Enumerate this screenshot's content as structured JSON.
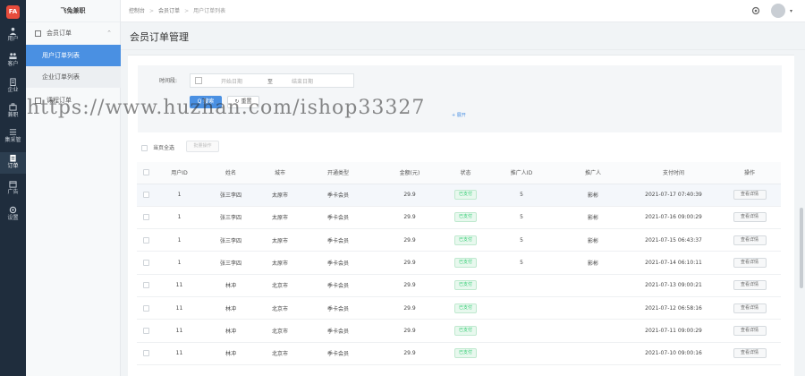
{
  "app": {
    "logo_text": "FA"
  },
  "rail": {
    "items": [
      {
        "label": "用户",
        "icon": "user-icon"
      },
      {
        "label": "客户",
        "icon": "customer-icon"
      },
      {
        "label": "企业",
        "icon": "building-icon"
      },
      {
        "label": "兼职",
        "icon": "briefcase-icon"
      },
      {
        "label": "集采管",
        "icon": "list-icon"
      },
      {
        "label": "订单",
        "icon": "order-icon",
        "active": true
      },
      {
        "label": "广告",
        "icon": "calendar-icon"
      },
      {
        "label": "设置",
        "icon": "gear-icon"
      }
    ]
  },
  "sidebar": {
    "brand": "飞兔兼职",
    "group1": "会员订单",
    "sub1": "用户订单列表",
    "sub2": "企业订单列表",
    "group2": "课程订单"
  },
  "breadcrumb": {
    "items": [
      "控制台",
      "会员订单",
      "用户订单列表"
    ]
  },
  "page": {
    "title": "会员订单管理"
  },
  "filter": {
    "label": "时间段:",
    "start_placeholder": "开始日期",
    "to": "至",
    "end_placeholder": "结束日期",
    "search_label": "Q 搜索",
    "reset_label": "↻ 重置",
    "expand_label": "+ 展开"
  },
  "toolbar": {
    "select_all": "当页全选",
    "batch_label": "批量操作"
  },
  "table": {
    "columns": [
      "用户ID",
      "姓名",
      "城市",
      "开通类型",
      "金额(元)",
      "状态",
      "推广人ID",
      "推广人",
      "支付时间",
      "操作"
    ],
    "rows": [
      {
        "id": "1",
        "name": "张三李四",
        "city": "太原市",
        "type": "季卡会员",
        "amount": "29.9",
        "status": "已支付",
        "pid": "5",
        "promoter": "影彬",
        "time": "2021-07-17 07:40:39",
        "action": "查看详情"
      },
      {
        "id": "1",
        "name": "张三李四",
        "city": "太原市",
        "type": "季卡会员",
        "amount": "29.9",
        "status": "已支付",
        "pid": "5",
        "promoter": "影彬",
        "time": "2021-07-16 09:00:29",
        "action": "查看详情"
      },
      {
        "id": "1",
        "name": "张三李四",
        "city": "太原市",
        "type": "季卡会员",
        "amount": "29.9",
        "status": "已支付",
        "pid": "5",
        "promoter": "影彬",
        "time": "2021-07-15 06:43:37",
        "action": "查看详情"
      },
      {
        "id": "1",
        "name": "张三李四",
        "city": "太原市",
        "type": "季卡会员",
        "amount": "29.9",
        "status": "已支付",
        "pid": "5",
        "promoter": "影彬",
        "time": "2021-07-14 06:10:11",
        "action": "查看详情"
      },
      {
        "id": "11",
        "name": "林冲",
        "city": "北京市",
        "type": "季卡会员",
        "amount": "29.9",
        "status": "已支付",
        "pid": "",
        "promoter": "",
        "time": "2021-07-13 09:00:21",
        "action": "查看详情"
      },
      {
        "id": "11",
        "name": "林冲",
        "city": "北京市",
        "type": "季卡会员",
        "amount": "29.9",
        "status": "已支付",
        "pid": "",
        "promoter": "",
        "time": "2021-07-12 06:58:16",
        "action": "查看详情"
      },
      {
        "id": "11",
        "name": "林冲",
        "city": "北京市",
        "type": "季卡会员",
        "amount": "29.9",
        "status": "已支付",
        "pid": "",
        "promoter": "",
        "time": "2021-07-11 09:00:29",
        "action": "查看详情"
      },
      {
        "id": "11",
        "name": "林冲",
        "city": "北京市",
        "type": "季卡会员",
        "amount": "29.9",
        "status": "已支付",
        "pid": "",
        "promoter": "",
        "time": "2021-07-10 09:00:16",
        "action": "查看详情"
      }
    ]
  },
  "watermark": "https://www.huzhan.com/ishop33327",
  "colors": {
    "rail_bg": "#1f2d3d",
    "accent": "#4a90e2",
    "paid_green": "#2ecc71"
  }
}
